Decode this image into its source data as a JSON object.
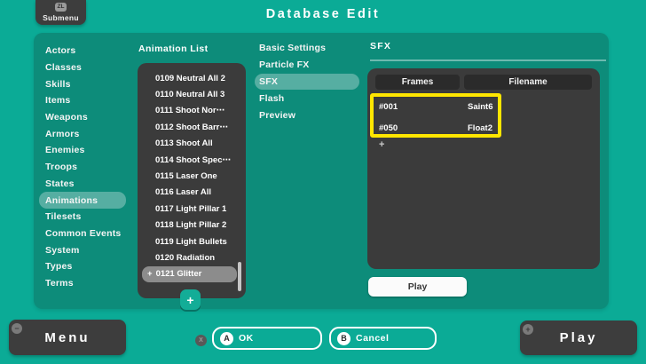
{
  "colors": {
    "background": "#0bab96",
    "panel": "#0d8c7a",
    "dark_panel": "#3b3b3b",
    "column_button": "#2b2b2b",
    "highlight_yellow": "#ffe600",
    "selected_row_gray": "#8c8c8c",
    "add_button_teal": "#13ad97"
  },
  "top_bar": {
    "submenu": {
      "icon": "ZL",
      "label": "Submenu"
    },
    "title": "Database Edit"
  },
  "sidebar": {
    "items": [
      "Actors",
      "Classes",
      "Skills",
      "Items",
      "Weapons",
      "Armors",
      "Enemies",
      "Troops",
      "States",
      "Animations",
      "Tilesets",
      "Common Events",
      "System",
      "Types",
      "Terms"
    ],
    "selected": "Animations"
  },
  "animation_list": {
    "title": "Animation List",
    "items": [
      "0109 Neutral All 2",
      "0110 Neutral All 3",
      "0111 Shoot Nor⋯",
      "0112 Shoot Barr⋯",
      "0113 Shoot All",
      "0114 Shoot Spec⋯",
      "0115 Laser One",
      "0116 Laser All",
      "0117 Light Pillar 1",
      "0118 Light Pillar 2",
      "0119 Light Bullets",
      "0120 Radiation",
      "0121 Glitter"
    ],
    "selected": "0121 Glitter",
    "selected_prefix": "+",
    "add_label": "+"
  },
  "settings_menu": {
    "items": [
      "Basic Settings",
      "Particle FX",
      "SFX",
      "Flash",
      "Preview"
    ],
    "selected": "SFX"
  },
  "sfx": {
    "title": "SFX",
    "columns": [
      "Frames",
      "Filename"
    ],
    "rows": [
      {
        "frame": "#001",
        "filename": "Saint6"
      },
      {
        "frame": "#050",
        "filename": "Float2"
      }
    ],
    "add_label": "+",
    "play_label": "Play"
  },
  "bottom_bar": {
    "menu": {
      "icon": "−",
      "label": "Menu"
    },
    "x_icon": "X",
    "ok": {
      "icon": "A",
      "label": "OK"
    },
    "cancel": {
      "icon": "B",
      "label": "Cancel"
    },
    "play": {
      "icon": "+",
      "label": "Play"
    }
  }
}
